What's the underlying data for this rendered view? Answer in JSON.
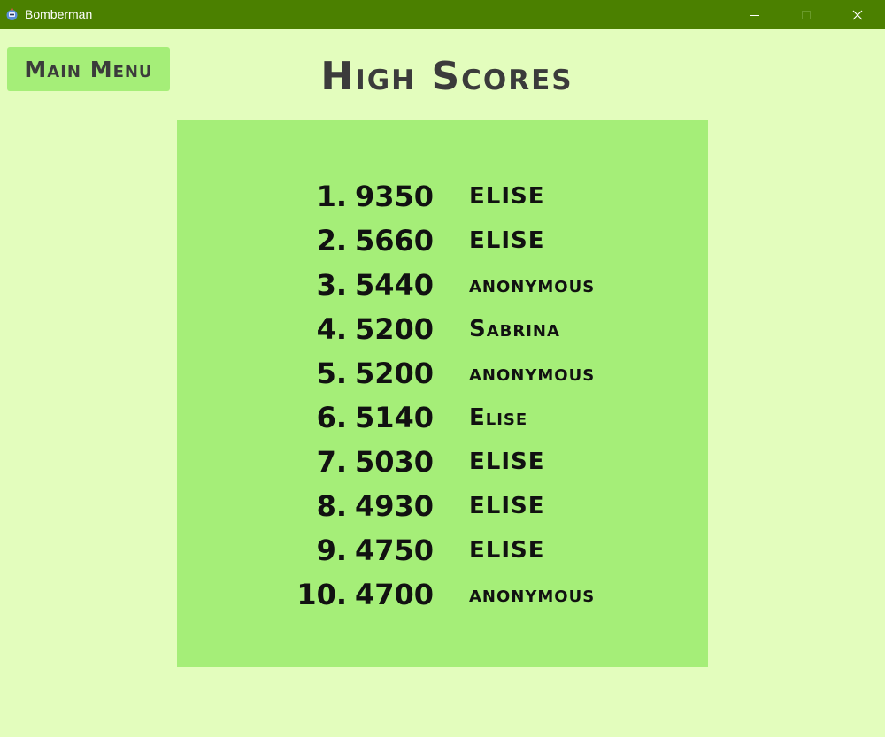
{
  "window": {
    "title": "Bomberman",
    "app_icon": "bomberman-app-icon",
    "controls": {
      "minimize_icon": "minimize-icon",
      "maximize_icon": "maximize-icon",
      "close_icon": "close-icon"
    },
    "titlebar_color": "#4b8000"
  },
  "colors": {
    "background": "#e3fdbd",
    "panel": "#a5ee78",
    "button": "#a5ee78",
    "title_text": "#3b3b3b",
    "score_text": "#111111"
  },
  "menu_button": {
    "label": "Main Menu"
  },
  "page": {
    "title": "High Scores"
  },
  "high_scores": [
    {
      "rank": "1.",
      "score": "9350",
      "name": "ELISE"
    },
    {
      "rank": "2.",
      "score": "5660",
      "name": "ELISE"
    },
    {
      "rank": "3.",
      "score": "5440",
      "name": "anonymous"
    },
    {
      "rank": "4.",
      "score": "5200",
      "name": "Sabrina"
    },
    {
      "rank": "5.",
      "score": "5200",
      "name": "anonymous"
    },
    {
      "rank": "6.",
      "score": "5140",
      "name": "Elise"
    },
    {
      "rank": "7.",
      "score": "5030",
      "name": "ELISE"
    },
    {
      "rank": "8.",
      "score": "4930",
      "name": "ELISE"
    },
    {
      "rank": "9.",
      "score": "4750",
      "name": "ELISE"
    },
    {
      "rank": "10.",
      "score": "4700",
      "name": "anonymous"
    }
  ]
}
